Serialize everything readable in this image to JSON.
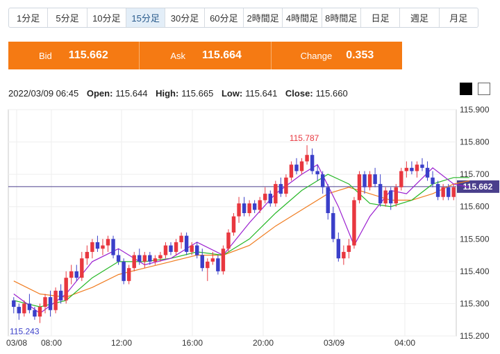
{
  "timeframes": [
    "1分足",
    "5分足",
    "10分足",
    "15分足",
    "30分足",
    "60分足",
    "2時間足",
    "4時間足",
    "8時間足",
    "日足",
    "週足",
    "月足"
  ],
  "active_timeframe": "15分足",
  "quote": {
    "bid_label": "Bid",
    "bid_value": "115.662",
    "ask_label": "Ask",
    "ask_value": "115.664",
    "change_label": "Change",
    "change_value": "0.353"
  },
  "ohlc": {
    "datetime": "2022/03/09 06:45",
    "open_label": "Open:",
    "open": "115.644",
    "high_label": "High:",
    "high": "115.665",
    "low_label": "Low:",
    "low": "115.641",
    "close_label": "Close:",
    "close": "115.660"
  },
  "colors": {
    "up": "#e8373f",
    "down": "#3a3fc9",
    "ma_short": "#9b1fd0",
    "ma_mid": "#27b827",
    "ma_long": "#f07c20",
    "accent": "#f57a13",
    "price_line": "#4a3f8c"
  },
  "chart_data": {
    "type": "candlestick",
    "ylim": [
      115.2,
      115.9
    ],
    "yticks": [
      "115.900",
      "115.800",
      "115.700",
      "115.600",
      "115.500",
      "115.400",
      "115.300",
      "115.200"
    ],
    "xticks": [
      "03/08",
      "08:00",
      "12:00",
      "16:00",
      "20:00",
      "03/09",
      "04:00"
    ],
    "current_price": "115.662",
    "max_label": "115.787",
    "min_label": "115.243",
    "candles": [
      [
        115.31,
        115.32,
        115.27,
        115.29
      ],
      [
        115.29,
        115.3,
        115.25,
        115.27
      ],
      [
        115.27,
        115.31,
        115.26,
        115.3
      ],
      [
        115.3,
        115.33,
        115.27,
        115.28
      ],
      [
        115.28,
        115.29,
        115.25,
        115.26
      ],
      [
        115.26,
        115.3,
        115.24,
        115.29
      ],
      [
        115.29,
        115.33,
        115.27,
        115.32
      ],
      [
        115.32,
        115.34,
        115.26,
        115.28
      ],
      [
        115.28,
        115.35,
        115.27,
        115.34
      ],
      [
        115.34,
        115.36,
        115.3,
        115.31
      ],
      [
        115.31,
        115.4,
        115.3,
        115.38
      ],
      [
        115.38,
        115.42,
        115.36,
        115.4
      ],
      [
        115.4,
        115.42,
        115.37,
        115.38
      ],
      [
        115.38,
        115.46,
        115.37,
        115.44
      ],
      [
        115.44,
        115.48,
        115.42,
        115.46
      ],
      [
        115.46,
        115.5,
        115.44,
        115.49
      ],
      [
        115.49,
        115.51,
        115.46,
        115.47
      ],
      [
        115.47,
        115.5,
        115.45,
        115.48
      ],
      [
        115.48,
        115.51,
        115.46,
        115.5
      ],
      [
        115.5,
        115.51,
        115.44,
        115.45
      ],
      [
        115.45,
        115.47,
        115.42,
        115.43
      ],
      [
        115.43,
        115.44,
        115.36,
        115.37
      ],
      [
        115.37,
        115.42,
        115.36,
        115.41
      ],
      [
        115.41,
        115.46,
        115.4,
        115.45
      ],
      [
        115.45,
        115.47,
        115.42,
        115.43
      ],
      [
        115.43,
        115.46,
        115.41,
        115.45
      ],
      [
        115.45,
        115.46,
        115.42,
        115.43
      ],
      [
        115.43,
        115.45,
        115.42,
        115.44
      ],
      [
        115.44,
        115.46,
        115.43,
        115.45
      ],
      [
        115.45,
        115.49,
        115.44,
        115.48
      ],
      [
        115.48,
        115.49,
        115.45,
        115.46
      ],
      [
        115.46,
        115.5,
        115.45,
        115.49
      ],
      [
        115.49,
        115.52,
        115.47,
        115.51
      ],
      [
        115.51,
        115.52,
        115.45,
        115.46
      ],
      [
        115.46,
        115.49,
        115.45,
        115.48
      ],
      [
        115.48,
        115.49,
        115.44,
        115.45
      ],
      [
        115.45,
        115.47,
        115.4,
        115.41
      ],
      [
        115.41,
        115.44,
        115.37,
        115.43
      ],
      [
        115.43,
        115.46,
        115.42,
        115.44
      ],
      [
        115.44,
        115.45,
        115.39,
        115.4
      ],
      [
        115.4,
        115.48,
        115.39,
        115.47
      ],
      [
        115.47,
        115.53,
        115.46,
        115.52
      ],
      [
        115.52,
        115.58,
        115.51,
        115.57
      ],
      [
        115.57,
        115.63,
        115.55,
        115.61
      ],
      [
        115.61,
        115.63,
        115.57,
        115.58
      ],
      [
        115.58,
        115.62,
        115.57,
        115.61
      ],
      [
        115.61,
        115.62,
        115.58,
        115.59
      ],
      [
        115.59,
        115.63,
        115.58,
        115.62
      ],
      [
        115.62,
        115.66,
        115.61,
        115.64
      ],
      [
        115.64,
        115.65,
        115.6,
        115.61
      ],
      [
        115.61,
        115.68,
        115.6,
        115.67
      ],
      [
        115.67,
        115.69,
        115.63,
        115.64
      ],
      [
        115.64,
        115.7,
        115.63,
        115.69
      ],
      [
        115.69,
        115.74,
        115.68,
        115.73
      ],
      [
        115.73,
        115.75,
        115.7,
        115.71
      ],
      [
        115.71,
        115.75,
        115.7,
        115.74
      ],
      [
        115.74,
        115.79,
        115.73,
        115.76
      ],
      [
        115.76,
        115.78,
        115.7,
        115.71
      ],
      [
        115.71,
        115.73,
        115.68,
        115.7
      ],
      [
        115.7,
        115.71,
        115.64,
        115.66
      ],
      [
        115.66,
        115.67,
        115.56,
        115.58
      ],
      [
        115.58,
        115.6,
        115.49,
        115.5
      ],
      [
        115.5,
        115.52,
        115.43,
        115.44
      ],
      [
        115.44,
        115.48,
        115.42,
        115.46
      ],
      [
        115.46,
        115.5,
        115.44,
        115.48
      ],
      [
        115.48,
        115.63,
        115.47,
        115.62
      ],
      [
        115.62,
        115.71,
        115.61,
        115.7
      ],
      [
        115.7,
        115.71,
        115.64,
        115.66
      ],
      [
        115.66,
        115.71,
        115.65,
        115.7
      ],
      [
        115.7,
        115.72,
        115.66,
        115.67
      ],
      [
        115.67,
        115.7,
        115.6,
        115.61
      ],
      [
        115.61,
        115.66,
        115.6,
        115.65
      ],
      [
        115.65,
        115.66,
        115.59,
        115.61
      ],
      [
        115.61,
        115.67,
        115.6,
        115.66
      ],
      [
        115.66,
        115.72,
        115.65,
        115.71
      ],
      [
        115.71,
        115.74,
        115.69,
        115.72
      ],
      [
        115.72,
        115.74,
        115.7,
        115.71
      ],
      [
        115.71,
        115.74,
        115.69,
        115.73
      ],
      [
        115.73,
        115.75,
        115.71,
        115.72
      ],
      [
        115.72,
        115.74,
        115.68,
        115.69
      ],
      [
        115.69,
        115.71,
        115.66,
        115.67
      ],
      [
        115.67,
        115.68,
        115.62,
        115.63
      ],
      [
        115.63,
        115.67,
        115.62,
        115.66
      ],
      [
        115.66,
        115.67,
        115.62,
        115.63
      ],
      [
        115.63,
        115.67,
        115.62,
        115.66
      ]
    ],
    "ma_short": [
      [
        0,
        115.33
      ],
      [
        5,
        115.27
      ],
      [
        10,
        115.33
      ],
      [
        15,
        115.43
      ],
      [
        20,
        115.47
      ],
      [
        25,
        115.42
      ],
      [
        30,
        115.44
      ],
      [
        35,
        115.49
      ],
      [
        40,
        115.45
      ],
      [
        45,
        115.55
      ],
      [
        50,
        115.64
      ],
      [
        55,
        115.7
      ],
      [
        58,
        115.73
      ],
      [
        62,
        115.6
      ],
      [
        65,
        115.48
      ],
      [
        68,
        115.57
      ],
      [
        72,
        115.65
      ],
      [
        75,
        115.64
      ],
      [
        80,
        115.72
      ],
      [
        84,
        115.67
      ],
      [
        87,
        115.66
      ]
    ],
    "ma_mid": [
      [
        0,
        115.31
      ],
      [
        5,
        115.29
      ],
      [
        10,
        115.31
      ],
      [
        15,
        115.38
      ],
      [
        20,
        115.43
      ],
      [
        25,
        115.43
      ],
      [
        30,
        115.44
      ],
      [
        35,
        115.46
      ],
      [
        40,
        115.45
      ],
      [
        45,
        115.5
      ],
      [
        50,
        115.58
      ],
      [
        55,
        115.65
      ],
      [
        60,
        115.7
      ],
      [
        64,
        115.67
      ],
      [
        68,
        115.61
      ],
      [
        72,
        115.6
      ],
      [
        76,
        115.62
      ],
      [
        80,
        115.67
      ],
      [
        84,
        115.69
      ],
      [
        87,
        115.69
      ]
    ],
    "ma_long": [
      [
        0,
        115.37
      ],
      [
        5,
        115.33
      ],
      [
        10,
        115.32
      ],
      [
        15,
        115.35
      ],
      [
        20,
        115.39
      ],
      [
        25,
        115.41
      ],
      [
        30,
        115.43
      ],
      [
        35,
        115.45
      ],
      [
        40,
        115.45
      ],
      [
        45,
        115.48
      ],
      [
        50,
        115.54
      ],
      [
        55,
        115.59
      ],
      [
        60,
        115.64
      ],
      [
        64,
        115.66
      ],
      [
        68,
        115.64
      ],
      [
        72,
        115.62
      ],
      [
        76,
        115.62
      ],
      [
        80,
        115.64
      ],
      [
        84,
        115.67
      ],
      [
        87,
        115.68
      ]
    ]
  }
}
